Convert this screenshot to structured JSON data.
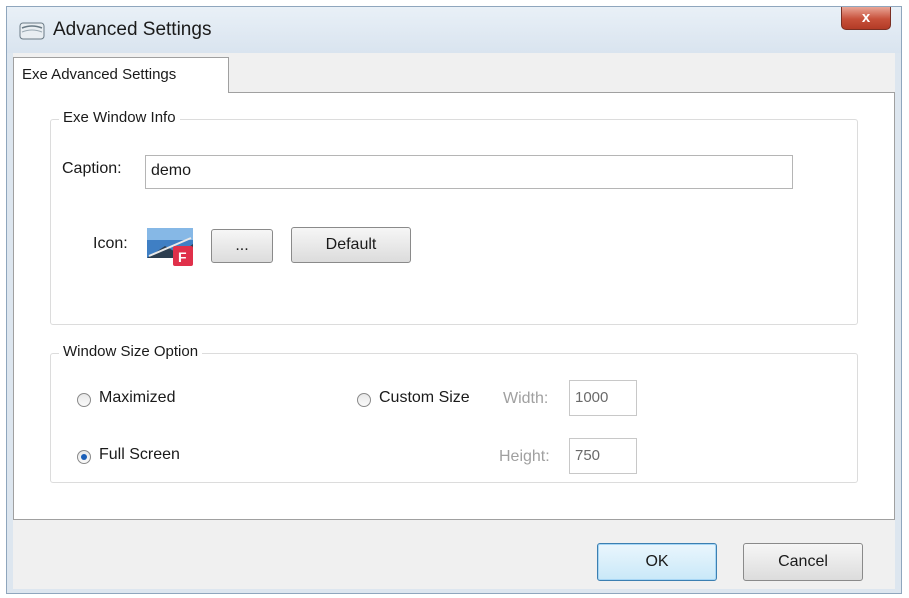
{
  "window": {
    "title": "Advanced Settings",
    "close_label": "x"
  },
  "tabs": [
    {
      "label": "Exe Advanced Settings"
    }
  ],
  "exe_window_info": {
    "legend": "Exe Window Info",
    "caption_label": "Caption:",
    "caption_value": "demo",
    "icon_label": "Icon:",
    "browse_label": "...",
    "default_label": "Default"
  },
  "window_size_option": {
    "legend": "Window Size Option",
    "maximized_label": "Maximized",
    "custom_size_label": "Custom Size",
    "full_screen_label": "Full Screen",
    "selected": "full_screen",
    "width_label": "Width:",
    "width_value": "1000",
    "height_label": "Height:",
    "height_value": "750"
  },
  "footer": {
    "ok_label": "OK",
    "cancel_label": "Cancel"
  },
  "colors": {
    "title_bar": "#dde6ef",
    "close_button": "#c7503a",
    "radio_dot": "#1b5fb8",
    "ok_border": "#3c7fb1"
  },
  "icons": {
    "app": "dialog-window-icon",
    "exe": "exe-f-icon"
  }
}
